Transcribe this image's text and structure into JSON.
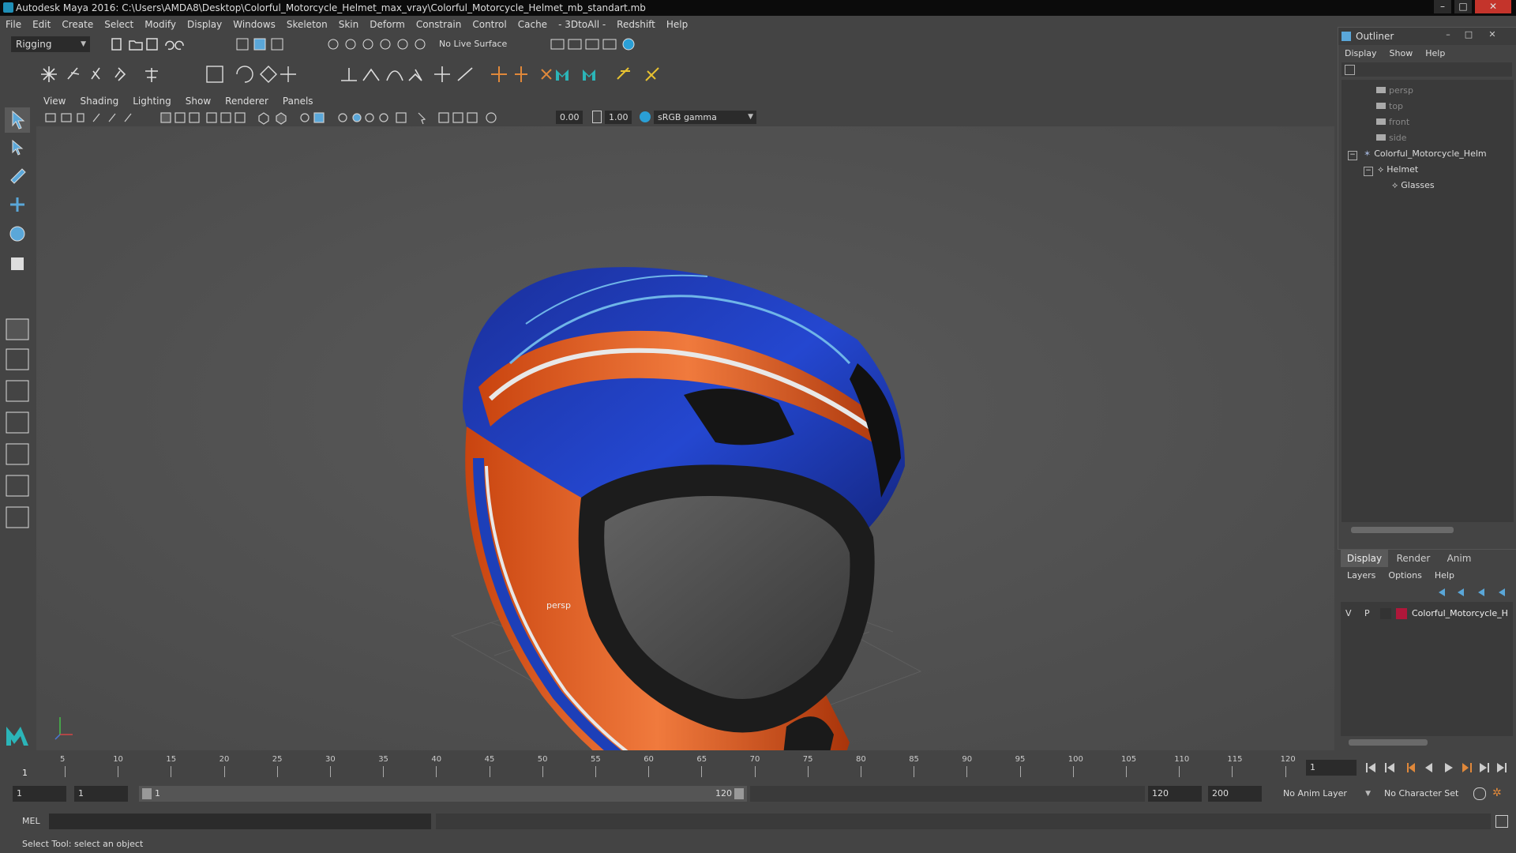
{
  "window": {
    "title": "Autodesk Maya 2016: C:\\Users\\AMDA8\\Desktop\\Colorful_Motorcycle_Helmet_max_vray\\Colorful_Motorcycle_Helmet_mb_standart.mb"
  },
  "menu": [
    "File",
    "Edit",
    "Create",
    "Select",
    "Modify",
    "Display",
    "Windows",
    "Skeleton",
    "Skin",
    "Deform",
    "Constrain",
    "Control",
    "Cache",
    "- 3DtoAll -",
    "Redshift",
    "Help"
  ],
  "status_line": {
    "mode": "Rigging",
    "live_surface": "No Live Surface"
  },
  "viewport": {
    "menu": [
      "View",
      "Shading",
      "Lighting",
      "Show",
      "Renderer",
      "Panels"
    ],
    "exposure": "0.00",
    "gamma": "1.00",
    "color_space": "sRGB gamma",
    "camera_label": "persp"
  },
  "outliner": {
    "title": "Outliner",
    "menu": [
      "Display",
      "Show",
      "Help"
    ],
    "items": [
      {
        "label": "persp"
      },
      {
        "label": "top"
      },
      {
        "label": "front"
      },
      {
        "label": "side"
      },
      {
        "label": "Colorful_Motorcycle_Helm"
      },
      {
        "label": "Helmet"
      },
      {
        "label": "Glasses"
      }
    ]
  },
  "layer_editor": {
    "tabs": [
      "Display",
      "Render",
      "Anim"
    ],
    "menu": [
      "Layers",
      "Options",
      "Help"
    ],
    "layer": {
      "v": "V",
      "p": "P",
      "name": "Colorful_Motorcycle_H",
      "color": "#b0173a"
    }
  },
  "timeline": {
    "ticks": [
      "5",
      "10",
      "15",
      "20",
      "25",
      "30",
      "35",
      "40",
      "45",
      "50",
      "55",
      "60",
      "65",
      "70",
      "75",
      "80",
      "85",
      "90",
      "95",
      "100",
      "105",
      "110",
      "115",
      "120"
    ],
    "start_marker": "1",
    "current_frame": "1"
  },
  "range": {
    "start": "1",
    "anim_start": "1",
    "slider_start": "1",
    "slider_end": "120",
    "end": "120",
    "anim_end": "200",
    "anim_layer": "No Anim Layer",
    "character_set": "No Character Set"
  },
  "command_line": {
    "label": "MEL"
  },
  "help_line": {
    "text": "Select Tool: select an object"
  },
  "colors": {
    "accent": "#5aa7d9",
    "helmet_blue": "#1d3fb8",
    "helmet_orange": "#d9541a"
  }
}
